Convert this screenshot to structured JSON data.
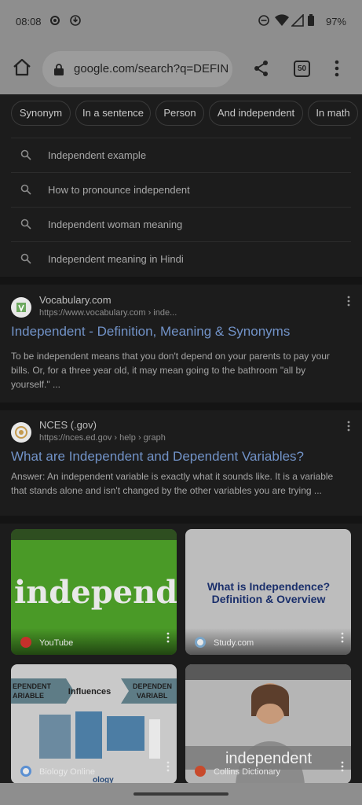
{
  "status_bar": {
    "time": "08:08",
    "battery": "97%"
  },
  "toolbar": {
    "url": "google.com/search?q=DEFINI",
    "tab_count": "50"
  },
  "chips": [
    "Synonym",
    "In a sentence",
    "Person",
    "And independent",
    "In math"
  ],
  "suggestions": [
    "Independent example",
    "How to pronounce independent",
    "Independent woman meaning",
    "Independent meaning in Hindi"
  ],
  "results": [
    {
      "site": "Vocabulary.com",
      "crumb": "https://www.vocabulary.com › inde...",
      "title": "Independent - Definition, Meaning & Synonyms",
      "snippet": "To be independent means that you don't depend on your parents to pay your bills. Or, for a three year old, it may mean going to the bathroom \"all by yourself.\" ..."
    },
    {
      "site": "NCES (.gov)",
      "crumb": "https://nces.ed.gov › help › graph",
      "title": "What are Independent and Dependent Variables?",
      "snippet": "Answer: An independent variable is exactly what it sounds like. It is a variable that stands alone and isn't changed by the other variables you are trying ..."
    }
  ],
  "videos": [
    {
      "source": "YouTube",
      "thumb_text": "independent"
    },
    {
      "source": "Study.com",
      "thumb_text_1": "What is Independence?",
      "thumb_text_2": "Definition & Overview"
    },
    {
      "source": "Biology Online",
      "thumb_left": "EPENDENT\nARIABLE",
      "thumb_mid": "Influences",
      "thumb_right": "DEPENDEN\nVARIABL",
      "thumb_bottom": "ology"
    },
    {
      "source": "Collins Dictionary",
      "thumb_text": "independent"
    }
  ],
  "colors": {
    "link": "#8ab4f8",
    "chrome": "#8e8e8e",
    "background": "#1c1c1c"
  }
}
